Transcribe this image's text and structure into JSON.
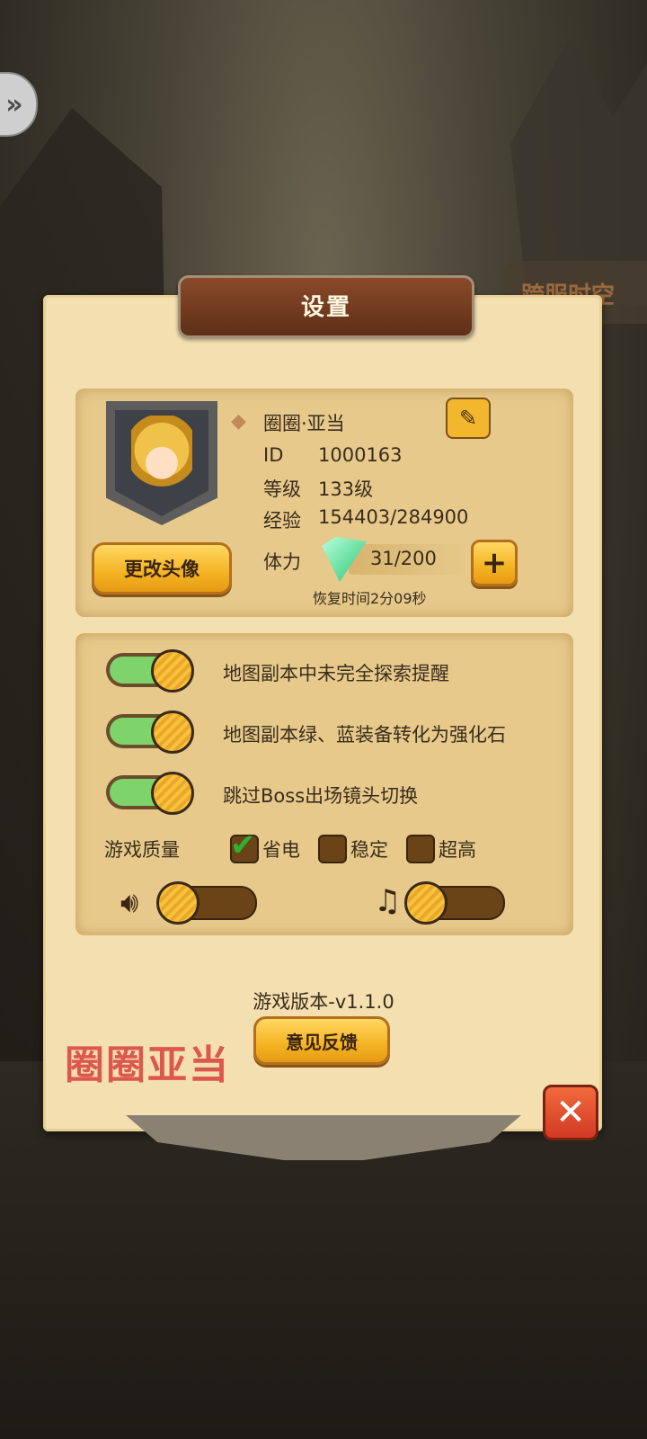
{
  "header": {
    "title": "设置",
    "bg_tab_label": "跨服时空"
  },
  "profile": {
    "name": "圈圈·亚当",
    "change_avatar_label": "更改头像",
    "id_label": "ID",
    "id_value": "1000163",
    "level_label": "等级",
    "level_value": "133级",
    "exp_label": "经验",
    "exp_value": "154403/284900",
    "stamina_label": "体力",
    "stamina_value": "31/200",
    "recover_text": "恢复时间2分09秒",
    "plus_label": "+"
  },
  "options": {
    "toggles": [
      {
        "label": "地图副本中未完全探索提醒",
        "on": true
      },
      {
        "label": "地图副本绿、蓝装备转化为强化石",
        "on": true
      },
      {
        "label": "跳过Boss出场镜头切换",
        "on": true
      }
    ],
    "quality_label": "游戏质量",
    "quality_options": [
      "省电",
      "稳定",
      "超高"
    ],
    "quality_selected": "省电",
    "sound_level": 0,
    "music_level": 0
  },
  "footer": {
    "version": "游戏版本-v1.1.0",
    "feedback_label": "意见反馈",
    "watermark": "圈圈亚当",
    "close_label": "✕"
  },
  "icons": {
    "back": "double-chevron-right-icon",
    "edit": "edit-note-icon",
    "gem": "stamina-gem-icon",
    "speaker": "speaker-icon",
    "music": "music-note-icon",
    "close": "close-icon"
  },
  "colors": {
    "panel": "#f3dfb0",
    "accent": "#f4b323",
    "toggle_on": "#7ed36a",
    "close": "#d23a24"
  }
}
